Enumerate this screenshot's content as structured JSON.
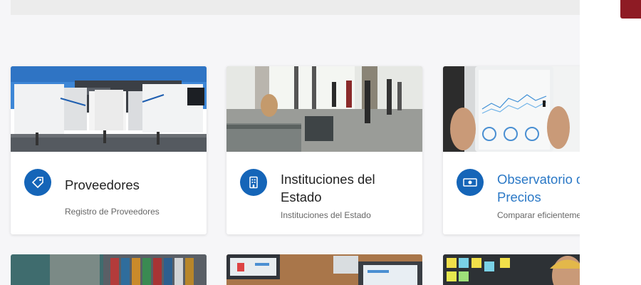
{
  "cards": [
    {
      "title": "Proveedores",
      "subtitle": "Registro de Proveedores",
      "icon": "tag-icon",
      "image": "trailers-loading-dock"
    },
    {
      "title": "Instituciones del Estado",
      "subtitle": "Instituciones del Estado",
      "icon": "building-icon",
      "image": "office-lobby"
    },
    {
      "title": "Observatorio de Precios",
      "subtitle": "Comparar eficientemente",
      "icon": "cash-icon",
      "image": "tablet-analytics"
    }
  ],
  "lower_cards": [
    {
      "image": "container-port"
    },
    {
      "image": "laptop-desk"
    },
    {
      "image": "sticky-notes-board"
    }
  ],
  "colors": {
    "icon_bg": "#1565b8",
    "link_title": "#2a78c6",
    "accent_tab": "#8e1b24",
    "page_bg": "#f6f6f8"
  }
}
